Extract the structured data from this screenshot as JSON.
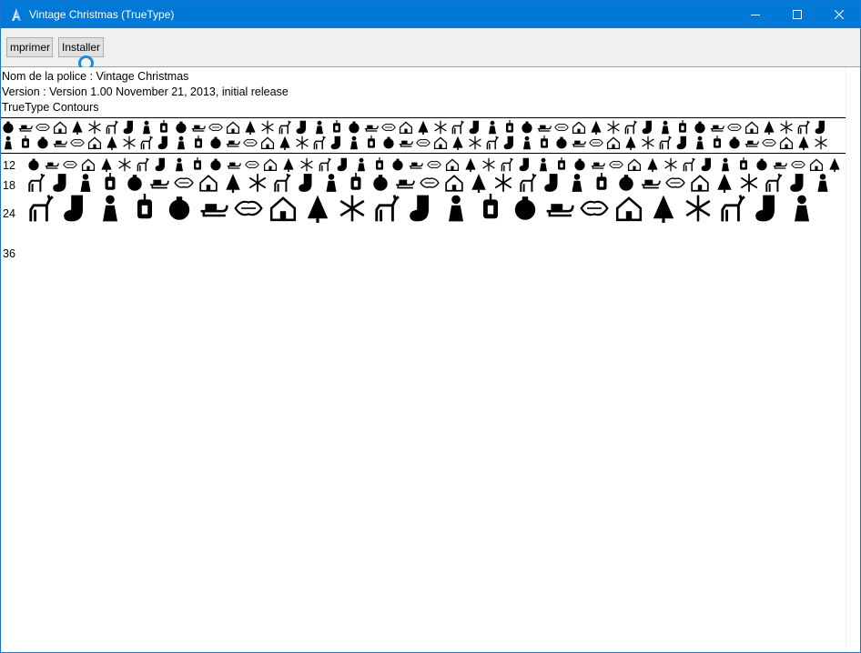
{
  "window": {
    "title": "Vintage Christmas (TrueType)",
    "app_icon": "font-viewer-icon",
    "controls": [
      "minimize-icon",
      "maximize-icon",
      "close-icon"
    ]
  },
  "toolbar": {
    "print_label": "mprimer",
    "install_label": "Installer"
  },
  "font_info": {
    "name_line": "Nom de la police : Vintage Christmas",
    "version_line": "Version : Version 1.00 November 21, 2013, initial release",
    "type_line": "TrueType  Contours"
  },
  "samples": {
    "sizes": [
      "12",
      "18",
      "24",
      "36"
    ],
    "glyph_style": "christmas-ornament-dingbats"
  },
  "colors": {
    "titlebar": "#0078d7",
    "toolbar": "#f0f0f0",
    "button": "#e1e1e1",
    "cursor": "#1e88e5"
  }
}
